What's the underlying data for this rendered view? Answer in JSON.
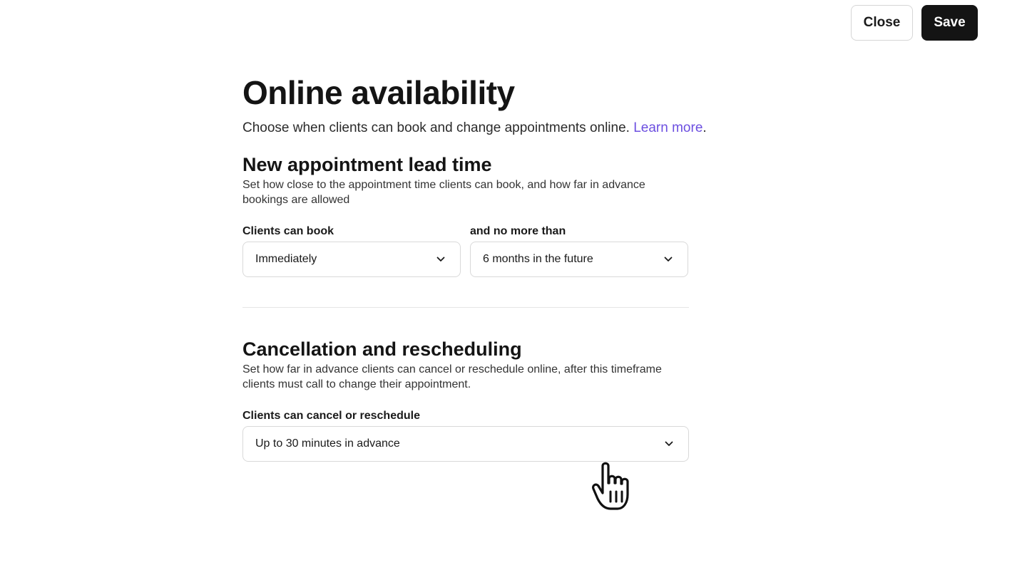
{
  "header": {
    "close_label": "Close",
    "save_label": "Save"
  },
  "page": {
    "title": "Online availability",
    "subtitle": "Choose when clients can book and change appointments online.",
    "learn_more": "Learn more",
    "learn_more_suffix": ".",
    "link_color": "#6c4fe0"
  },
  "lead_time": {
    "title": "New appointment lead time",
    "description": "Set how close to the appointment time clients can book, and how far in advance bookings are allowed",
    "clients_can_book": {
      "label": "Clients can book",
      "value": "Immediately"
    },
    "no_more_than": {
      "label": "and no more than",
      "value": "6 months in the future"
    }
  },
  "cancellation": {
    "title": "Cancellation and rescheduling",
    "description": "Set how far in advance clients can cancel or reschedule online, after this timeframe clients must call to change their appointment.",
    "cancel_or_reschedule": {
      "label": "Clients can cancel or reschedule",
      "value": "Up to 30 minutes in advance"
    }
  },
  "icons": {
    "chevron": "chevron-down-icon",
    "cursor": "hand-pointer-icon"
  },
  "colors": {
    "primary_button": "#141414",
    "border": "#d9d9d9"
  }
}
